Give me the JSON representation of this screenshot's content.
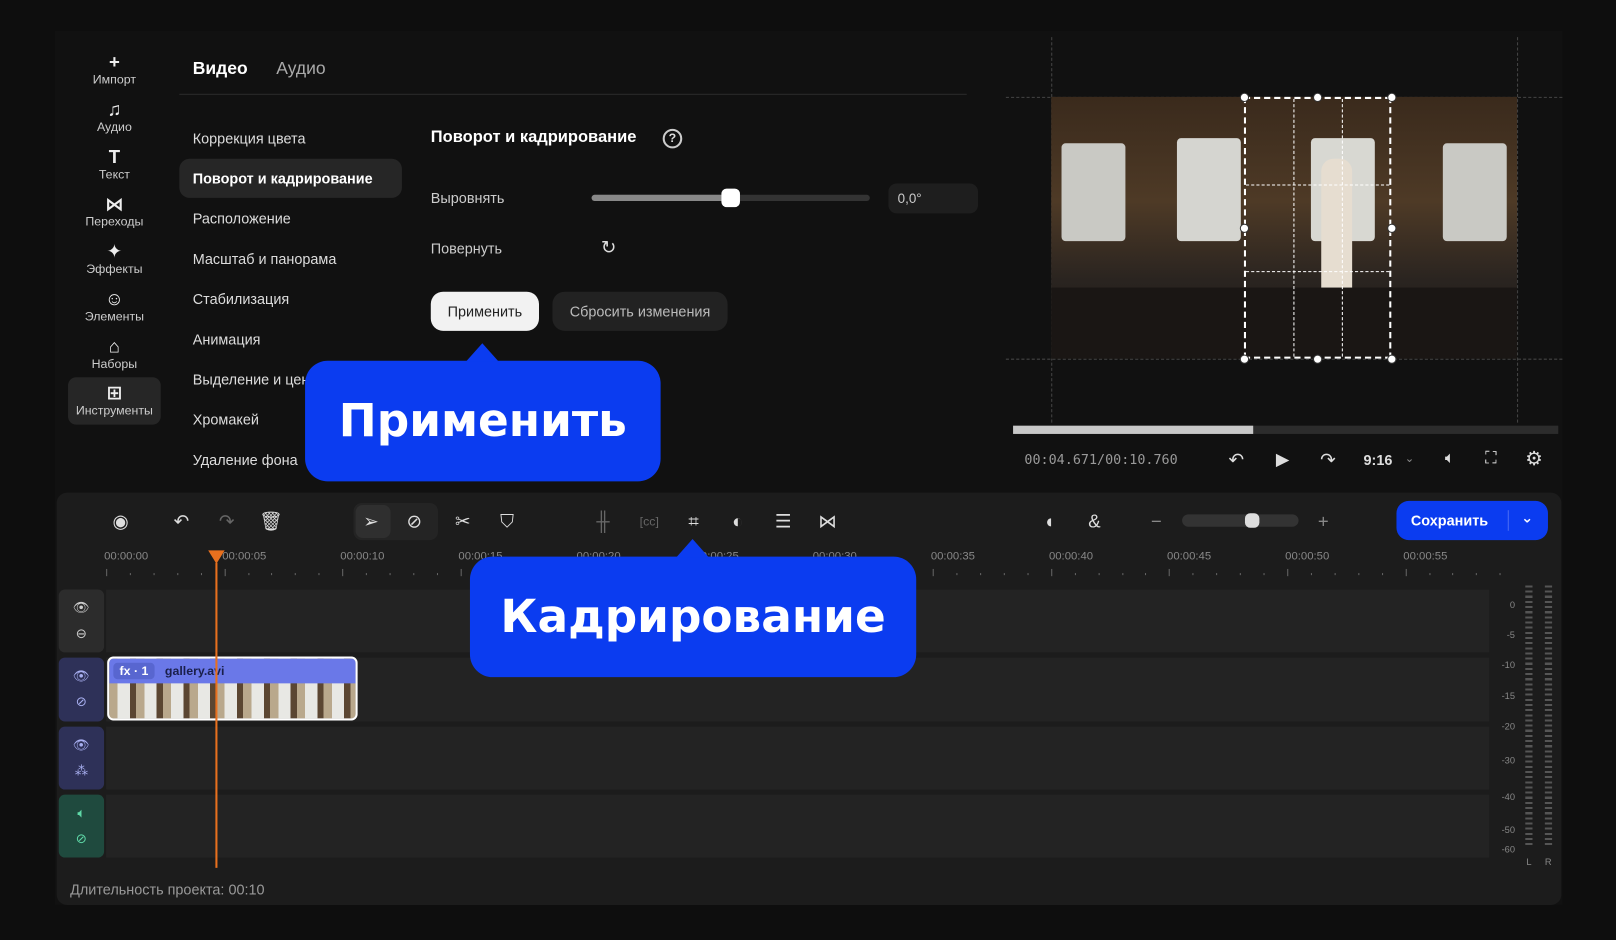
{
  "sidebar": {
    "items": [
      {
        "label": "Импорт",
        "icon": "plus-icon",
        "glyph": "+"
      },
      {
        "label": "Аудио",
        "icon": "music-note-icon",
        "glyph": "♫"
      },
      {
        "label": "Текст",
        "icon": "text-icon",
        "glyph": "T"
      },
      {
        "label": "Переходы",
        "icon": "transitions-icon",
        "glyph": "⋈"
      },
      {
        "label": "Эффекты",
        "icon": "sparkle-icon",
        "glyph": "✦"
      },
      {
        "label": "Элементы",
        "icon": "smiley-icon",
        "glyph": "☺"
      },
      {
        "label": "Наборы",
        "icon": "bag-icon",
        "glyph": "⌂"
      },
      {
        "label": "Инструменты",
        "icon": "tools-grid-icon",
        "glyph": "⊞"
      }
    ]
  },
  "tabs": {
    "video": "Видео",
    "audio": "Аудио"
  },
  "menu": [
    "Коррекция цвета",
    "Поворот и кадрирование",
    "Расположение",
    "Масштаб и панорама",
    "Стабилизация",
    "Анимация",
    "Выделение и цензура",
    "Хромакей",
    "Удаление фона"
  ],
  "panel": {
    "title": "Поворот и кадрирование",
    "align_label": "Выровнять",
    "align_value": "0,0°",
    "align_fraction": 0.5,
    "rotate_label": "Повернуть",
    "apply": "Применить",
    "reset": "Сбросить изменения"
  },
  "player": {
    "time": "00:04.671/00:10.760",
    "progress": 0.44,
    "aspect": "9:16"
  },
  "callouts": {
    "apply": "Применить",
    "crop": "Кадрирование"
  },
  "toolbar": {
    "save": "Сохранить",
    "zoom_fraction": 0.6
  },
  "ruler": [
    "00:00:00",
    "00:00:05",
    "00:00:10",
    "00:00:15",
    "00:00:20",
    "00:00:25",
    "00:00:30",
    "00:00:35",
    "00:00:40",
    "00:00:45",
    "00:00:50",
    "00:00:55"
  ],
  "clip": {
    "badge": "fx · 1",
    "name": "gallery.avi"
  },
  "meter": {
    "scale": [
      "0",
      "-5",
      "-10",
      "-15",
      "-20",
      "-30",
      "-40",
      "-50",
      "-60"
    ],
    "left": "L",
    "right": "R"
  },
  "footer": {
    "duration": "Длительность проекта: 00:10"
  },
  "colors": {
    "accent": "#0b3cf0",
    "playhead": "#e8701e",
    "clip": "#6a78e8"
  }
}
